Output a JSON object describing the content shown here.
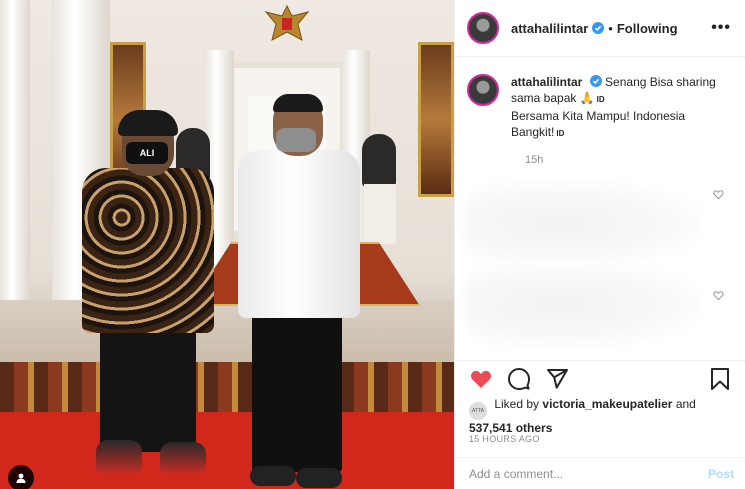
{
  "post": {
    "username": "attahalilintar",
    "separator": "•",
    "follow_state": "Following",
    "more_label": "•••",
    "photo_mask_text": "ALI"
  },
  "caption": {
    "username": "attahalilintar",
    "text_line1": "Senang Bisa sharing sama bapak 🙏",
    "tag1": "ID",
    "text_line2": "Bersama Kita Mampu! Indonesia Bangkit!",
    "tag2": "ID",
    "time": "15h"
  },
  "likes": {
    "avatar_text": "ATTA",
    "prefix": "Liked by",
    "liker": "victoria_makeupatelier",
    "conjunction": "and",
    "others": "537,541 others"
  },
  "timestamp": "15 HOURS AGO",
  "add_comment": {
    "placeholder": "Add a comment...",
    "post_label": "Post"
  },
  "icons": {
    "verified": "verified-badge-icon",
    "heart": "heart-filled-icon",
    "comment": "comment-icon",
    "share": "share-icon",
    "save": "bookmark-icon",
    "user_tag": "user-tag-icon"
  },
  "colors": {
    "like_red": "#ed4956",
    "verified_blue": "#3897f0",
    "post_disabled": "#b3dbff",
    "muted": "#8e8e8e"
  }
}
